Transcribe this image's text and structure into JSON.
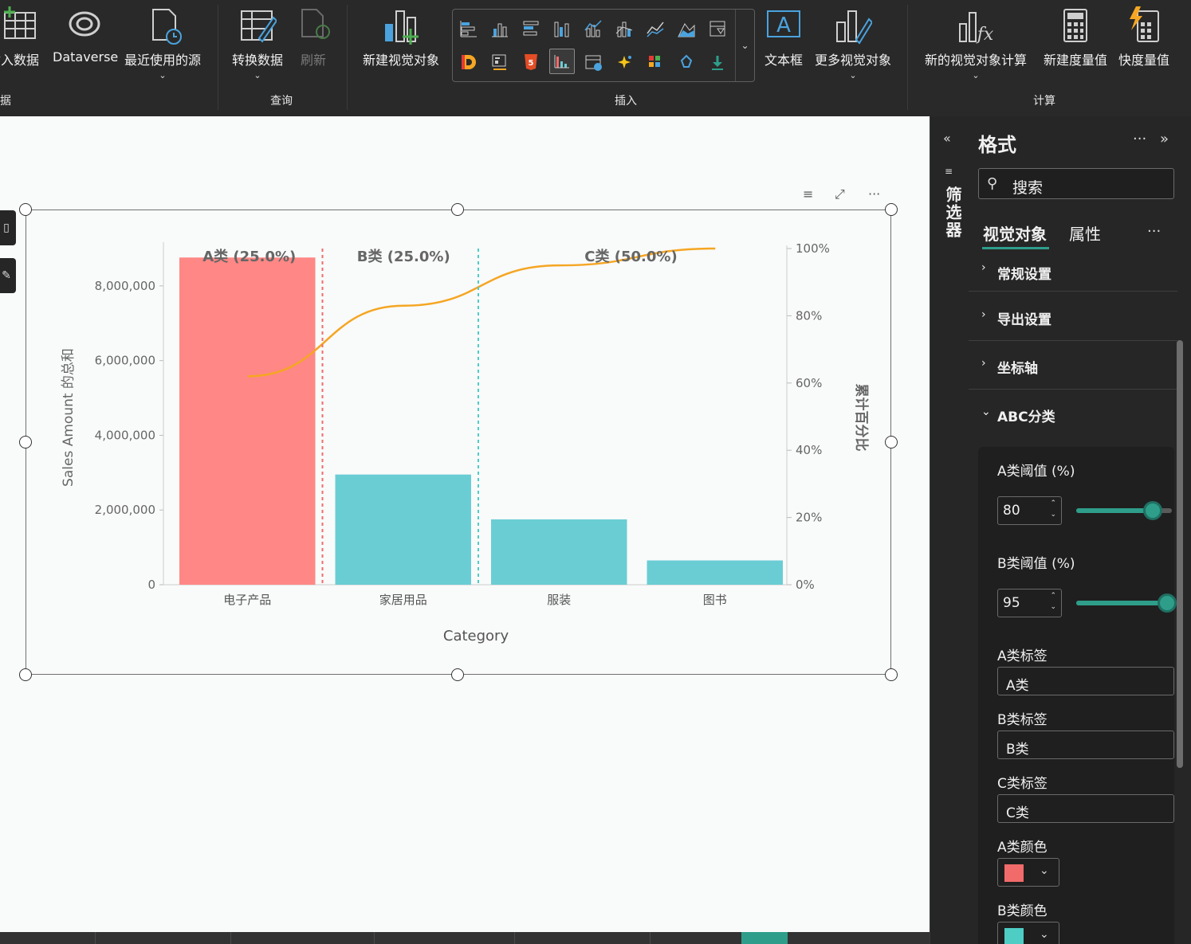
{
  "ribbon": {
    "buttons": [
      {
        "label": "输入数据",
        "disabled": false
      },
      {
        "label": "Dataverse",
        "disabled": false
      },
      {
        "label": "最近使用的源",
        "disabled": false
      },
      {
        "label": "转换数据",
        "disabled": false
      },
      {
        "label": "刷新",
        "disabled": true
      },
      {
        "label": "新建视觉对象",
        "disabled": false
      },
      {
        "label": "文本框",
        "disabled": false
      },
      {
        "label": "更多视觉对象",
        "disabled": false
      },
      {
        "label": "新的视觉对象计算",
        "disabled": false
      },
      {
        "label": "新建度量值",
        "disabled": false
      },
      {
        "label": "快度量值",
        "disabled": false
      }
    ],
    "groups": {
      "data": "据",
      "query": "查询",
      "insert": "插入",
      "calc": "计算"
    }
  },
  "filter_pane": {
    "label": "筛选器"
  },
  "format_pane": {
    "title": "格式",
    "search_placeholder": "搜索",
    "tabs": [
      "视觉对象",
      "属性"
    ],
    "sections": [
      "常规设置",
      "导出设置",
      "坐标轴",
      "ABC分类"
    ],
    "abc": {
      "a_threshold_label": "A类阈值 (%)",
      "a_threshold_value": "80",
      "a_threshold_pct": 80,
      "b_threshold_label": "B类阈值 (%)",
      "b_threshold_value": "95",
      "b_threshold_pct": 95,
      "a_label_title": "A类标签",
      "a_label_value": "A类",
      "b_label_title": "B类标签",
      "b_label_value": "B类",
      "c_label_title": "C类标签",
      "c_label_value": "C类",
      "a_color_title": "A类颜色",
      "a_color": "#f26b6b",
      "b_color_title": "B类颜色",
      "b_color": "#4ecdc4"
    }
  },
  "chart_data": {
    "type": "bar",
    "categories": [
      "电子产品",
      "家居用品",
      "服装",
      "图书"
    ],
    "values": [
      8760000,
      2950000,
      1750000,
      650000
    ],
    "cumulative_pct": [
      62,
      83,
      95,
      100
    ],
    "bar_colors": [
      "#ff8785",
      "#6acdd4",
      "#6acdd4",
      "#6acdd4"
    ],
    "line_color": "#f5a623",
    "xlabel": "Category",
    "ylabel": "Sales Amount 的总和",
    "y2label": "累计百分比",
    "ylim": [
      0,
      9000000
    ],
    "y_ticks": [
      "0",
      "2,000,000",
      "4,000,000",
      "6,000,000",
      "8,000,000"
    ],
    "y_tick_values": [
      0,
      2000000,
      4000000,
      6000000,
      8000000
    ],
    "y2_ticks": [
      "0%",
      "20%",
      "40%",
      "60%",
      "80%",
      "100%"
    ],
    "y2_tick_values": [
      0,
      20,
      40,
      60,
      80,
      100
    ],
    "zone_labels": [
      "A类 (25.0%)",
      "B类 (25.0%)",
      "C类 (50.0%)"
    ],
    "divider_colors": [
      "#f26b6b",
      "#4ecdc4"
    ]
  }
}
